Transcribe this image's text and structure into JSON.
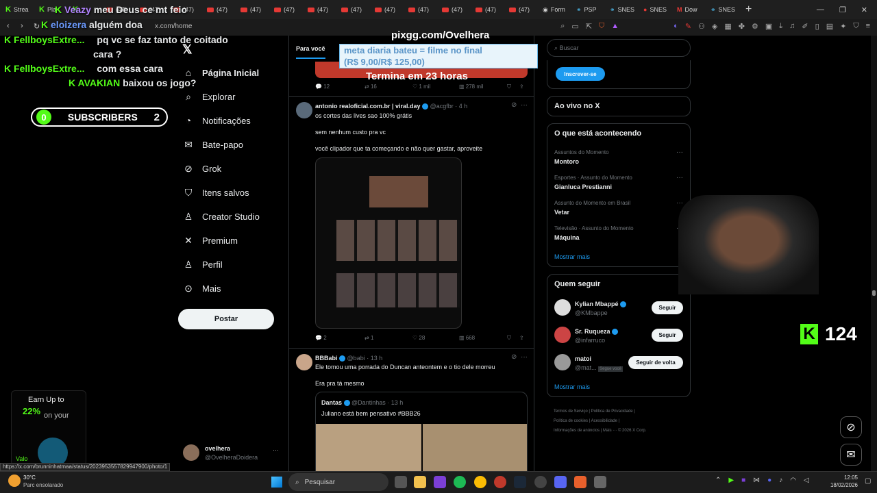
{
  "browser": {
    "tabs": [
      "Strea",
      "Pla",
      "",
      "(47)",
      "(47)",
      "(47)",
      "(47)",
      "(47)",
      "(47)",
      "(47)",
      "(47)",
      "(47)",
      "(47)",
      "(47)",
      "(47)",
      "(47)",
      "Form",
      "PSP",
      "SNES",
      "SNES",
      "Dow",
      "SNES"
    ],
    "url": "x.com/home",
    "status_url": "https://x.com/brunninhatmaa/status/2023953557829947900/photo/1"
  },
  "stream_chat": [
    {
      "user": "Veazy",
      "msg": "meu Deus ce mt feio",
      "color": "#b284ff"
    },
    {
      "user": "eloizera",
      "msg": "alguém doa",
      "color": "#6c9bff"
    },
    {
      "user": "FellboysExtre...",
      "msg": "pq vc se faz tanto de coitado",
      "color": "#53fc18"
    },
    {
      "user": "",
      "msg": "cara ?",
      "color": "#fff"
    },
    {
      "user": "FellboysExtre...",
      "msg": "com essa cara",
      "color": "#53fc18"
    },
    {
      "user": "AVAKIAN",
      "msg": "baixou os jogo?",
      "color": "#53fc18"
    }
  ],
  "subs_widget": {
    "left": "0",
    "label": "SUBSCRIBERS",
    "right": "2"
  },
  "x_nav": {
    "items": [
      "Página Inicial",
      "Explorar",
      "Notificações",
      "Bate-papo",
      "Grok",
      "Itens salvos",
      "Creator Studio",
      "Premium",
      "Perfil",
      "Mais"
    ],
    "post_button": "Postar",
    "account_name": "ovelhera",
    "account_handle": "@OvelheraDoidera"
  },
  "feed": {
    "tab_active": "Para você",
    "top_actions": [
      "12",
      "16",
      "1 mil",
      "278 mil"
    ],
    "top_footer": "Termina em 23 horas",
    "tweet1": {
      "name": "antonio realoficial.com.br | viral.day",
      "handle": "@acgfbr",
      "time": "4 h",
      "line1": "os cortes das lives sao 100% grátis",
      "line2": "sem nenhum custo pra vc",
      "line3": "você clipador que ta começando e não quer gastar, aproveite",
      "actions": [
        "2",
        "1",
        "28",
        "668"
      ]
    },
    "tweet2": {
      "name": "BBBabi",
      "handle": "@babi",
      "time": "13 h",
      "line1": "Ele tomou uma porrada do Duncan anteontem e o tio dele morreu",
      "line2": "Era pra tá mesmo",
      "quote_name": "Dantas",
      "quote_handle": "@Dantinhas",
      "quote_time": "13 h",
      "quote_text": "Juliano está bem pensativo #BBB26"
    }
  },
  "donation_alert": {
    "site": "pixgg.com/Ovelhera",
    "line1": "meta diaria bateu = filme no final",
    "line2": "(R$ 9,00/R$ 125,00)"
  },
  "sidebar": {
    "search_placeholder": "Buscar",
    "subscribe": "Inscrever-se",
    "live_title": "Ao vivo no X",
    "trends_title": "O que está acontecendo",
    "trends": [
      {
        "ctx": "Assuntos do Momento",
        "name": "Montoro"
      },
      {
        "ctx": "Esportes · Assunto do Momento",
        "name": "Gianluca Prestianni"
      },
      {
        "ctx": "Assunto do Momento em Brasil",
        "name": "Vetar"
      },
      {
        "ctx": "Televisão · Assunto do Momento",
        "name": "Máquina"
      }
    ],
    "show_more": "Mostrar mais",
    "who_title": "Quem seguir",
    "who": [
      {
        "name": "Kylian Mbappé",
        "handle": "@KMbappe",
        "btn": "Seguir"
      },
      {
        "name": "Sr. Ruqueza",
        "handle": "@infarruco",
        "btn": "Seguir"
      },
      {
        "name": "matoi",
        "handle": "@mat...",
        "badge": "Segue você",
        "btn": "Seguir de volta"
      }
    ],
    "footer": [
      "Termos de Serviço",
      "Política de Privacidade",
      "Política de cookies",
      "Acessibilidade",
      "Informações de anúncios",
      "Mais ···",
      "© 2026 X Corp."
    ]
  },
  "overlay_counter": "124",
  "promo": {
    "line1": "Earn Up to",
    "pct": "22%",
    "line2": "on your",
    "brand": "Valo"
  },
  "taskbar": {
    "temp": "30°C",
    "weather": "Parc ensolarado",
    "search": "Pesquisar",
    "time": "12:05",
    "date": "18/02/2026"
  }
}
